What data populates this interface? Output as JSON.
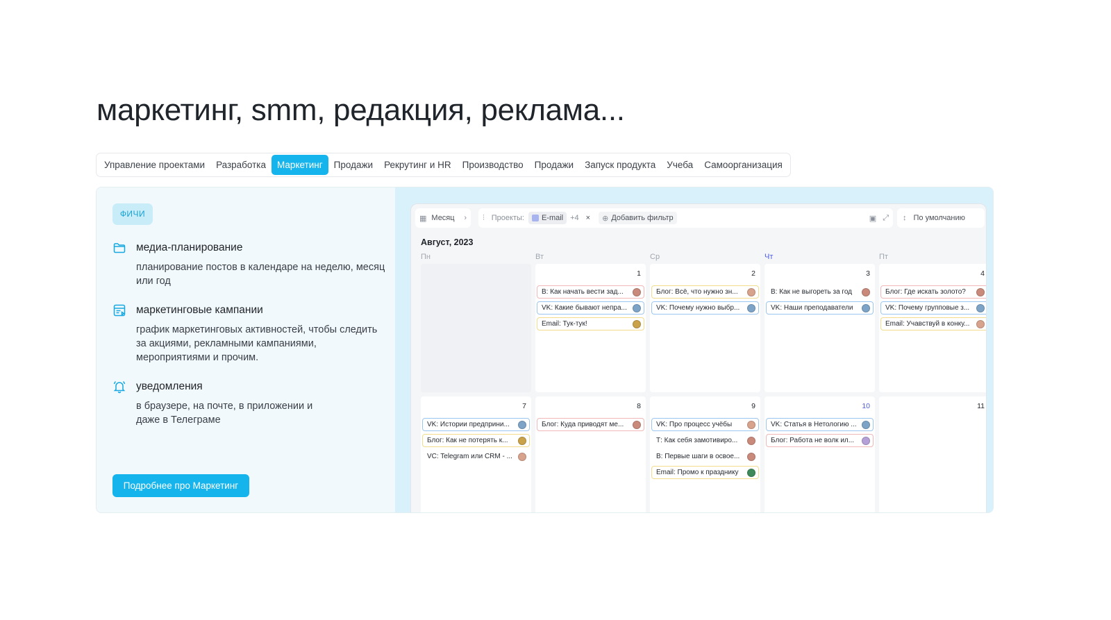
{
  "page": {
    "title": "маркетинг, smm, редакция, реклама..."
  },
  "tabs": [
    {
      "label": "Управление проектами",
      "active": false
    },
    {
      "label": "Разработка",
      "active": false
    },
    {
      "label": "Маркетинг",
      "active": true
    },
    {
      "label": "Продажи",
      "active": false
    },
    {
      "label": "Рекрутинг и HR",
      "active": false
    },
    {
      "label": "Производство",
      "active": false
    },
    {
      "label": "Продажи",
      "active": false
    },
    {
      "label": "Запуск продукта",
      "active": false
    },
    {
      "label": "Учеба",
      "active": false
    },
    {
      "label": "Самоорганизация",
      "active": false
    }
  ],
  "features": {
    "badge": "ФИЧИ",
    "items": [
      {
        "title": "медиа-планирование",
        "desc": "планирование постов в календаре на неделю, месяц или год",
        "icon": "folder-icon"
      },
      {
        "title": "маркетинговые кампании",
        "desc": "график маркетинговых активностей, чтобы следить за акциями, рекламными кампаниями, мероприятиями и прочим.",
        "icon": "campaign-icon"
      },
      {
        "title": "уведомления",
        "desc": "в браузере, на почте, в приложении и даже в Телеграме",
        "icon": "bell-icon"
      }
    ],
    "cta": "Подробнее про Маркетинг"
  },
  "calendar": {
    "toolbar": {
      "view": "Месяц",
      "projects_label": "Проекты:",
      "project_chip": "E-mail",
      "more_count": "+4",
      "remove": "×",
      "add_filter": "Добавить фильтр",
      "sort": "По умолчанию"
    },
    "month_label": "Август, 2023",
    "weekdays": [
      {
        "label": "Пн",
        "today": false
      },
      {
        "label": "Вт",
        "today": false
      },
      {
        "label": "Ср",
        "today": false
      },
      {
        "label": "Чт",
        "today": true
      },
      {
        "label": "Пт",
        "today": false
      }
    ],
    "weeks": [
      {
        "days": [
          {
            "num": "",
            "empty": true,
            "events": []
          },
          {
            "num": "1",
            "events": [
              {
                "text": "В: Как начать вести зад...",
                "color": "red",
                "avatar": "a1"
              },
              {
                "text": "VK: Какие бывают непра...",
                "color": "blue",
                "avatar": "a2"
              },
              {
                "text": "Email: Тук-тук!",
                "color": "yellow",
                "avatar": "a3"
              }
            ]
          },
          {
            "num": "2",
            "events": [
              {
                "text": "Блог: Всё, что нужно зн...",
                "color": "yellow",
                "avatar": "a4"
              },
              {
                "text": "VK: Почему нужно выбр...",
                "color": "blue",
                "avatar": "a2"
              }
            ]
          },
          {
            "num": "3",
            "events": [
              {
                "text": "В: Как не выгореть за год",
                "color": "plain",
                "avatar": "a1"
              },
              {
                "text": "VK: Наши преподаватели",
                "color": "blue",
                "avatar": "a2"
              }
            ]
          },
          {
            "num": "4",
            "events": [
              {
                "text": "Блог: Где искать золото?",
                "color": "red",
                "avatar": "a1"
              },
              {
                "text": "VK: Почему групповые з...",
                "color": "blue",
                "avatar": "a2"
              },
              {
                "text": "Email: Учавствуй в конку...",
                "color": "yellow",
                "avatar": "a4"
              }
            ]
          }
        ]
      },
      {
        "days": [
          {
            "num": "7",
            "events": [
              {
                "text": "VK: Истории предприни...",
                "color": "blue",
                "avatar": "a2"
              },
              {
                "text": "Блог: Как не потерять к...",
                "color": "yellow",
                "avatar": "a3"
              },
              {
                "text": "VC: Telegram или CRM - ...",
                "color": "plain",
                "avatar": "a4"
              }
            ]
          },
          {
            "num": "8",
            "events": [
              {
                "text": "Блог: Куда приводят ме...",
                "color": "red",
                "avatar": "a1"
              }
            ]
          },
          {
            "num": "9",
            "events": [
              {
                "text": "VK: Про процесс учёбы",
                "color": "blue",
                "avatar": "a4"
              },
              {
                "text": "Т: Как себя замотивиро...",
                "color": "plain",
                "avatar": "a1"
              },
              {
                "text": "В: Первые шаги в освое...",
                "color": "plain",
                "avatar": "a1"
              },
              {
                "text": "Email: Промо к празднику",
                "color": "yellow",
                "avatar": "a5"
              }
            ]
          },
          {
            "num": "10",
            "today": true,
            "events": [
              {
                "text": "VK: Статья в Нетологию ...",
                "color": "blue",
                "avatar": "a2"
              },
              {
                "text": "Блог: Работа не волк ил...",
                "color": "red",
                "avatar": "a6"
              }
            ]
          },
          {
            "num": "11",
            "events": []
          }
        ]
      }
    ]
  }
}
